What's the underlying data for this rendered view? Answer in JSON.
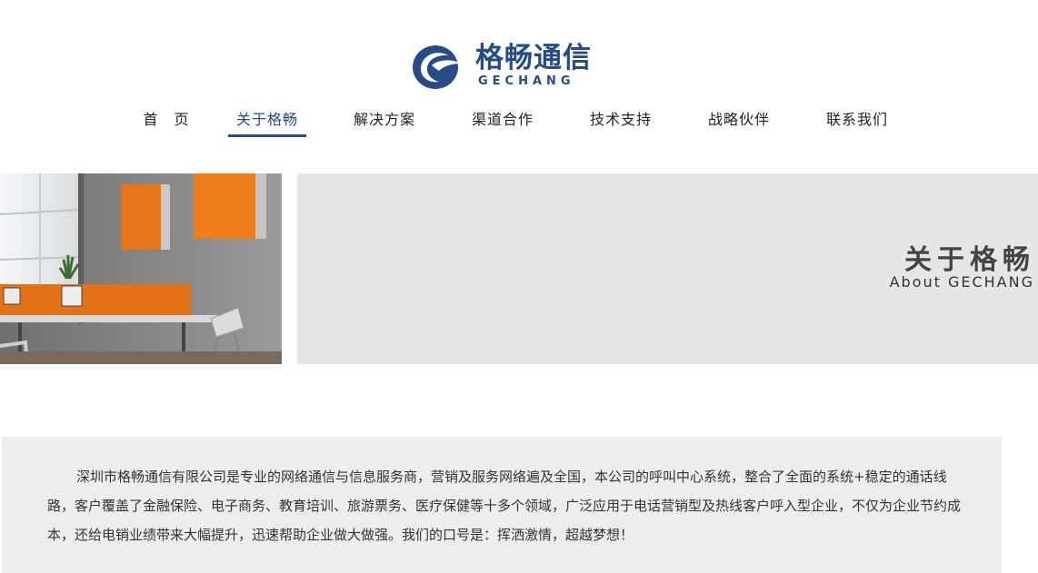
{
  "brand": {
    "name_cn": "格畅通信",
    "name_en": "GECHANG",
    "colors": {
      "primary": "#264b86",
      "panel": "#e6e6e6",
      "intro_bg": "#ededed",
      "accent_orange": "#e8751a"
    },
    "logo_icon": "gechang-swoosh-logo"
  },
  "nav": {
    "items": [
      {
        "label": "首　页",
        "active": false
      },
      {
        "label": "关于格畅",
        "active": true
      },
      {
        "label": "解决方案",
        "active": false
      },
      {
        "label": "渠道合作",
        "active": false
      },
      {
        "label": "技术支持",
        "active": false
      },
      {
        "label": "战略伙伴",
        "active": false
      },
      {
        "label": "联系我们",
        "active": false
      }
    ]
  },
  "banner": {
    "title": "关于格畅",
    "subtitle": "About  GECHANG",
    "photo": "office-interior-photo"
  },
  "intro": {
    "text": "深圳市格畅通信有限公司是专业的网络通信与信息服务商，营销及服务网络遍及全国，本公司的呼叫中心系统，整合了全面的系统+稳定的通话线路，客户覆盖了金融保险、电子商务、教育培训、旅游票务、医疗保健等十多个领域，广泛应用于电话营销型及热线客户呼入型企业，不仅为企业节约成本，还给电销业绩带来大幅提升，迅速帮助企业做大做强。我们的口号是：挥洒激情，超越梦想！"
  }
}
